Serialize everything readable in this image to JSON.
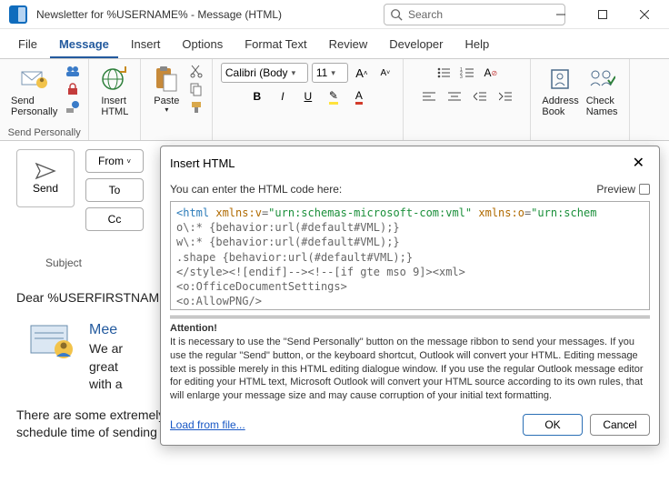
{
  "window": {
    "title": "Newsletter for %USERNAME%  -  Message (HTML)",
    "search_placeholder": "Search"
  },
  "tabs": {
    "file": "File",
    "message": "Message",
    "insert": "Insert",
    "options": "Options",
    "format": "Format Text",
    "review": "Review",
    "developer": "Developer",
    "help": "Help"
  },
  "ribbon": {
    "send_personally": "Send\nPersonally",
    "insert_html": "Insert\nHTML",
    "paste": "Paste",
    "group1": "Send Personally",
    "font_name": "Calibri (Body",
    "font_size": "11",
    "bold": "B",
    "italic": "I",
    "under": "U",
    "address_book": "Address\nBook",
    "check_names": "Check\nNames"
  },
  "compose": {
    "send": "Send",
    "from": "From",
    "to": "To",
    "cc": "Cc",
    "subject_label": "Subject",
    "greeting": "Dear %USERFIRSTNAME",
    "hero_title": "Mee",
    "hero_l1": "We ar",
    "hero_l2": "great",
    "hero_l3": "with a",
    "para2": "There are some extremely useful features that have been added in the new version. First, it's possible now to schedule time of sending messages and limit the number of outgoing emails per minute. Scheduling allows you"
  },
  "dialog": {
    "title": "Insert HTML",
    "instruction": "You can enter the HTML code here:",
    "preview": "Preview",
    "load": "Load from file...",
    "ok": "OK",
    "cancel": "Cancel",
    "attn_head": "Attention!",
    "attn_body": "It is necessary to use the \"Send Personally\" button on the message ribbon to send your messages. If you use the regular \"Send\" button, or the keyboard shortcut, Outlook will convert your HTML. Editing message text is possible merely in this HTML editing dialogue window. If you use the regular Outlook message editor for editing your HTML text, Microsoft Outlook will convert your HTML source according to its own rules, that will enlarge your message size and may cause corruption of your initial text formatting.",
    "code": {
      "l1a": "<html ",
      "l1b": "xmlns:v",
      "l1c": "=",
      "l1d": "\"urn:schemas-microsoft-com:vml\"",
      "l1e": " xmlns:o",
      "l1f": "=",
      "l1g": "\"urn:schem",
      "l2": "o\\:* {behavior:url(#default#VML);}",
      "l3": "w\\:* {behavior:url(#default#VML);}",
      "l4": ".shape {behavior:url(#default#VML);}",
      "l5": "</style><![endif]--><!--[if gte mso 9]><xml>",
      "l6": "<o:OfficeDocumentSettings>",
      "l7": "<o:AllowPNG/>"
    }
  }
}
